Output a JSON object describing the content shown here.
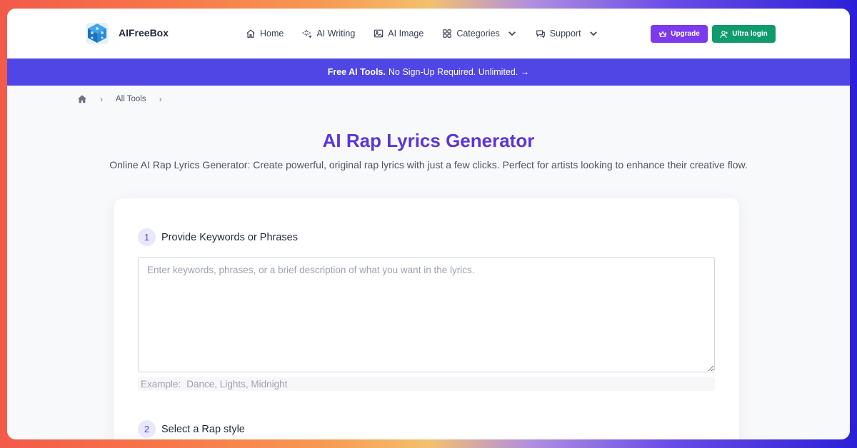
{
  "header": {
    "logo_text": "AIFreeBox",
    "nav": [
      {
        "label": "Home",
        "icon": "home-icon"
      },
      {
        "label": "AI Writing",
        "icon": "sparkles-icon"
      },
      {
        "label": "AI Image",
        "icon": "image-icon"
      },
      {
        "label": "Categories",
        "icon": "grid-icon",
        "dropdown": true
      },
      {
        "label": "Support",
        "icon": "chat-icon",
        "dropdown": true
      }
    ],
    "upgrade_label": "Upgrade",
    "login_label": "Ultra login"
  },
  "banner": {
    "bold_text": "Free AI Tools.",
    "text": "No Sign-Up Required. Unlimited. →"
  },
  "breadcrumb": {
    "items": [
      "All Tools"
    ]
  },
  "page": {
    "title": "AI Rap Lyrics Generator",
    "subtitle": "Online AI Rap Lyrics Generator: Create powerful, original rap lyrics with just a few clicks. Perfect for artists looking to enhance their creative flow."
  },
  "form": {
    "step1": {
      "number": "1",
      "label": "Provide Keywords or Phrases"
    },
    "keywords_placeholder": "Enter keywords, phrases, or a brief description of what you want in the lyrics.",
    "example_label": "Example:",
    "example_value": "Dance, Lights, Midnight",
    "step2": {
      "number": "2",
      "label": "Select a Rap style"
    }
  },
  "colors": {
    "brand_purple": "#5b35d9",
    "banner": "#4f46e5",
    "upgrade": "#7c3aed",
    "login": "#0f9b6e"
  }
}
